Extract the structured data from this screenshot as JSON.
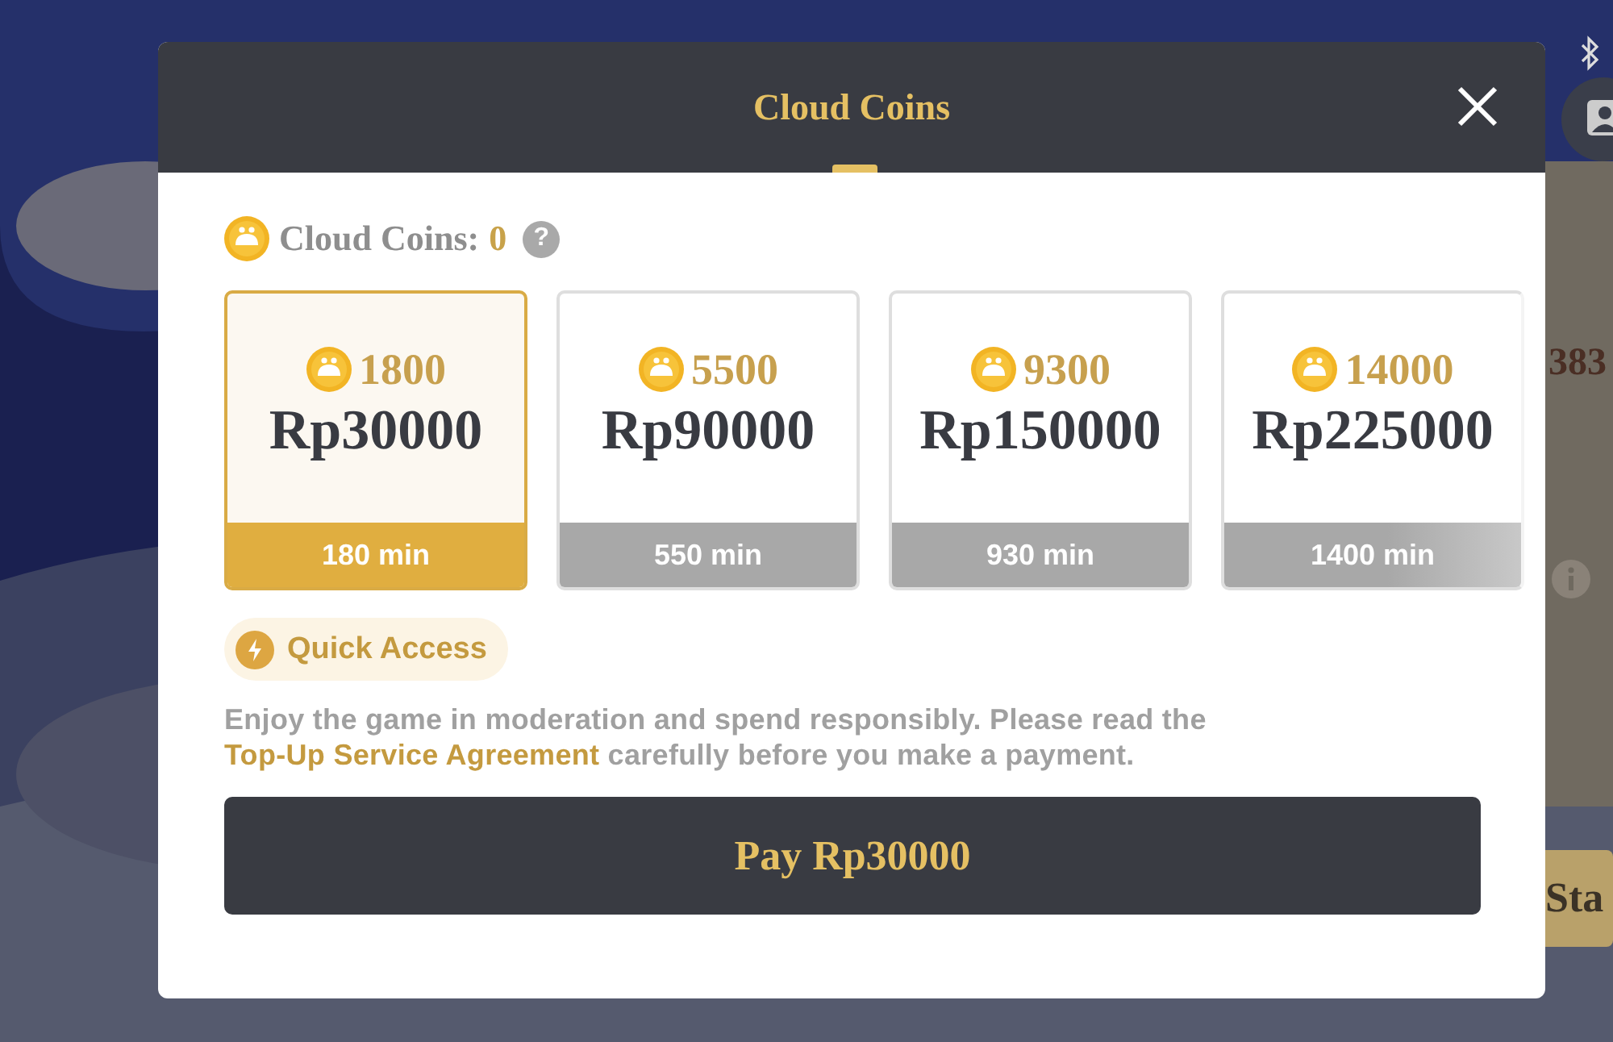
{
  "background": {
    "side_number": "383",
    "side_button": "Sta"
  },
  "dialog": {
    "title": "Cloud Coins",
    "balance_label": "Cloud Coins:",
    "balance": "0",
    "help": "?",
    "packages": [
      {
        "coins": "1800",
        "price": "Rp30000",
        "duration": "180 min",
        "selected": true
      },
      {
        "coins": "5500",
        "price": "Rp90000",
        "duration": "550 min",
        "selected": false
      },
      {
        "coins": "9300",
        "price": "Rp150000",
        "duration": "930 min",
        "selected": false
      },
      {
        "coins": "14000",
        "price": "Rp225000",
        "duration": "1400 min",
        "selected": false
      }
    ],
    "quick_access": "Quick Access",
    "notice": "Enjoy the game in moderation and spend responsibly. Please read the ",
    "notice_link": "Top-Up Service Agreement",
    "notice_end": " carefully before you make a payment.",
    "pay_button": "Pay Rp30000"
  }
}
